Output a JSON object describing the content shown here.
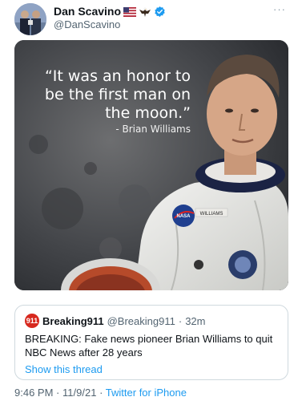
{
  "tweet": {
    "display_name": "Dan Scavino",
    "handle": "@DanScavino",
    "more_label": "···",
    "badge_icons": [
      "us-flag-icon",
      "eagle-icon",
      "verified-icon"
    ]
  },
  "media": {
    "quote": "“It was an honor to be the first man on the moon.”",
    "attribution": "- Brian Williams",
    "suit_patch": "NASA",
    "name_tag": "WILLIAMS"
  },
  "quoted_tweet": {
    "logo_text": "911",
    "name": "Breaking911",
    "handle": "@Breaking911",
    "separator": "·",
    "time": "32m",
    "text": "BREAKING: Fake news pioneer Brian Williams to quit NBC News after 28 years",
    "show_thread_label": "Show this thread"
  },
  "footer": {
    "time": "9:46 PM",
    "separator1": "·",
    "date": "11/9/21",
    "separator2": "·",
    "client": "Twitter for iPhone"
  },
  "colors": {
    "link": "#1d9bf0",
    "secondary_text": "#536471",
    "border": "#cfd9de",
    "breaking911_red": "#d7281e"
  }
}
